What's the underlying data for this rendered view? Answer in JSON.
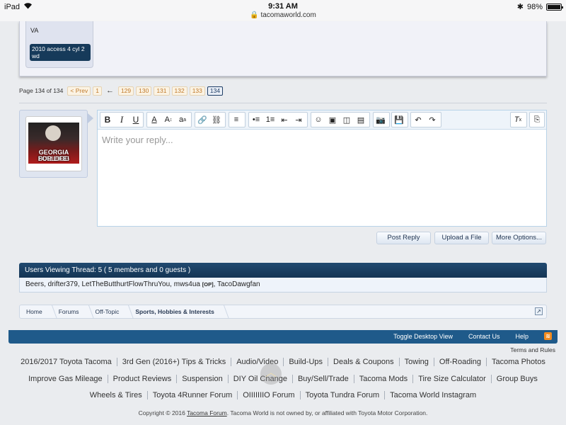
{
  "statusbar": {
    "device": "iPad",
    "time": "9:31 AM",
    "domain": "tacomaworld.com",
    "battery": "98%",
    "battery_level": 0.98
  },
  "post": {
    "location": "VA",
    "vehicle": "2010 access 4 cyl 2 wd"
  },
  "pagenav": {
    "label": "Page 134 of 134",
    "prev": "< Prev",
    "first": "1",
    "arrow": "←",
    "pages": [
      "129",
      "130",
      "131",
      "132",
      "133"
    ],
    "current": "134"
  },
  "avatar": {
    "line1": "GEORGIA BULLDOG",
    "line2": "FOR LIFE!"
  },
  "editor": {
    "placeholder": "Write your reply..."
  },
  "actions": {
    "post_reply": "Post Reply",
    "upload": "Upload a File",
    "more": "More Options..."
  },
  "users_viewing": {
    "header": "Users Viewing Thread: 5 ( 5 members and 0 guests )",
    "names_before": "Beers, drifter379, LetTheButthurtFlowThruYou, mws4ua",
    "op_tag": "[OP]",
    "names_after": ", TacoDawgfan"
  },
  "breadcrumb": [
    "Home",
    "Forums",
    "Off-Topic",
    "Sports, Hobbies & Interests"
  ],
  "footer": {
    "toggle": "Toggle Desktop View",
    "contact": "Contact Us",
    "help": "Help",
    "terms": "Terms and Rules"
  },
  "footnav_rows": [
    [
      "2016/2017 Toyota Tacoma",
      "3rd Gen (2016+) Tips & Tricks",
      "Audio/Video",
      "Build-Ups",
      "Deals & Coupons",
      "Towing",
      "Off-Roading",
      "Tacoma Photos"
    ],
    [
      "Improve Gas Mileage",
      "Product Reviews",
      "Suspension",
      "DIY Oil Change",
      "Buy/Sell/Trade",
      "Tacoma Mods",
      "Tire Size Calculator",
      "Group Buys"
    ],
    [
      "Wheels & Tires",
      "Toyota 4Runner Forum",
      "OIIIIIIIO Forum",
      "Toyota Tundra Forum",
      "Tacoma World Instagram"
    ]
  ],
  "copyright": {
    "before": "Copyright © 2016 ",
    "link": "Tacoma Forum",
    "after": ". Tacoma World is not owned by, or affiliated with Toyota Motor Corporation."
  }
}
